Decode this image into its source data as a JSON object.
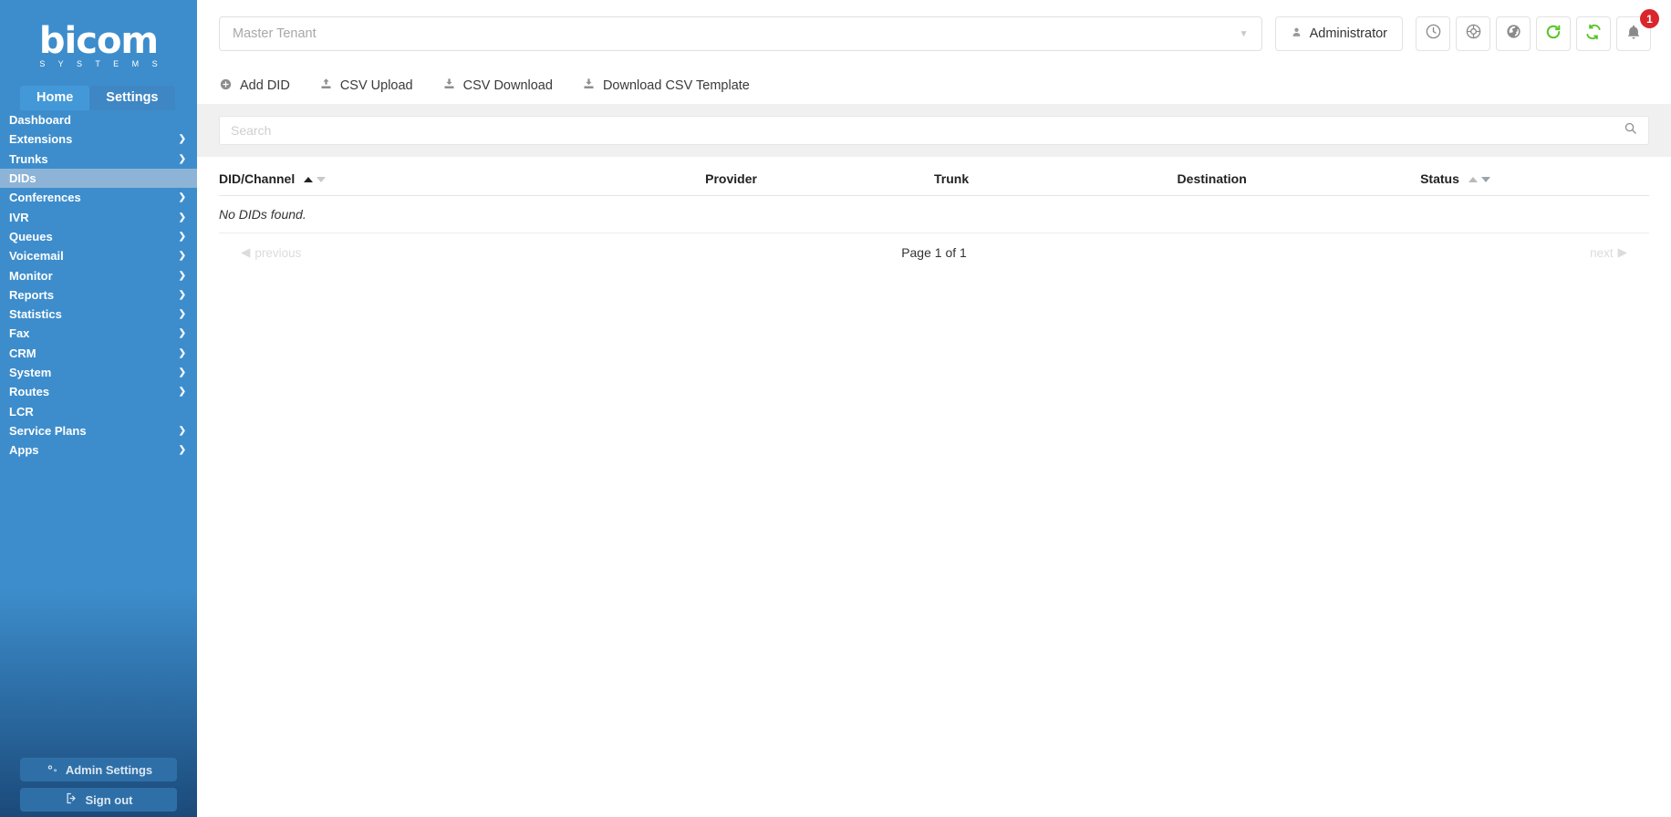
{
  "brand": {
    "name": "bicom",
    "tagline": "S Y S T E M S",
    "sidebar_color": "#3d8dcc",
    "active_item_color": "#8db4d6",
    "accent_green": "#4cbb17",
    "badge_color": "#d9262c"
  },
  "tabs": [
    {
      "label": "Home",
      "active": true
    },
    {
      "label": "Settings",
      "active": false
    }
  ],
  "sidebar": {
    "items": [
      {
        "label": "Dashboard",
        "has_chevron": false,
        "active": false
      },
      {
        "label": "Extensions",
        "has_chevron": true,
        "active": false
      },
      {
        "label": "Trunks",
        "has_chevron": true,
        "active": false
      },
      {
        "label": "DIDs",
        "has_chevron": false,
        "active": true
      },
      {
        "label": "Conferences",
        "has_chevron": true,
        "active": false
      },
      {
        "label": "IVR",
        "has_chevron": true,
        "active": false
      },
      {
        "label": "Queues",
        "has_chevron": true,
        "active": false
      },
      {
        "label": "Voicemail",
        "has_chevron": true,
        "active": false
      },
      {
        "label": "Monitor",
        "has_chevron": true,
        "active": false
      },
      {
        "label": "Reports",
        "has_chevron": true,
        "active": false
      },
      {
        "label": "Statistics",
        "has_chevron": true,
        "active": false
      },
      {
        "label": "Fax",
        "has_chevron": true,
        "active": false
      },
      {
        "label": "CRM",
        "has_chevron": true,
        "active": false
      },
      {
        "label": "System",
        "has_chevron": true,
        "active": false
      },
      {
        "label": "Routes",
        "has_chevron": true,
        "active": false
      },
      {
        "label": "LCR",
        "has_chevron": false,
        "active": false
      },
      {
        "label": "Service Plans",
        "has_chevron": true,
        "active": false
      },
      {
        "label": "Apps",
        "has_chevron": true,
        "active": false
      }
    ],
    "admin_settings_label": "Admin Settings",
    "sign_out_label": "Sign out"
  },
  "topbar": {
    "tenant_value": "Master Tenant",
    "tenant_placeholder": "Master Tenant",
    "user_label": "Administrator",
    "icons": [
      {
        "name": "clock-icon"
      },
      {
        "name": "lifebuoy-icon"
      },
      {
        "name": "globe-icon"
      },
      {
        "name": "reload-icon"
      },
      {
        "name": "sync-icon"
      },
      {
        "name": "bell-icon"
      }
    ],
    "notification_count": "1"
  },
  "toolbar": {
    "actions": [
      {
        "label": "Add DID",
        "icon": "plus-circle-icon"
      },
      {
        "label": "CSV Upload",
        "icon": "upload-icon"
      },
      {
        "label": "CSV Download",
        "icon": "download-icon"
      },
      {
        "label": "Download CSV Template",
        "icon": "download-icon"
      }
    ]
  },
  "search": {
    "value": "",
    "placeholder": "Search"
  },
  "table": {
    "columns": [
      {
        "label": "DID/Channel",
        "sortable": true,
        "sort": "asc"
      },
      {
        "label": "Provider",
        "sortable": false,
        "sort": "none"
      },
      {
        "label": "Trunk",
        "sortable": false,
        "sort": "none"
      },
      {
        "label": "Destination",
        "sortable": false,
        "sort": "none"
      },
      {
        "label": "Status",
        "sortable": true,
        "sort": "none"
      }
    ],
    "rows": [],
    "empty_message": "No DIDs found."
  },
  "pagination": {
    "previous_label": "previous",
    "page_label": "Page 1 of 1",
    "next_label": "next"
  }
}
